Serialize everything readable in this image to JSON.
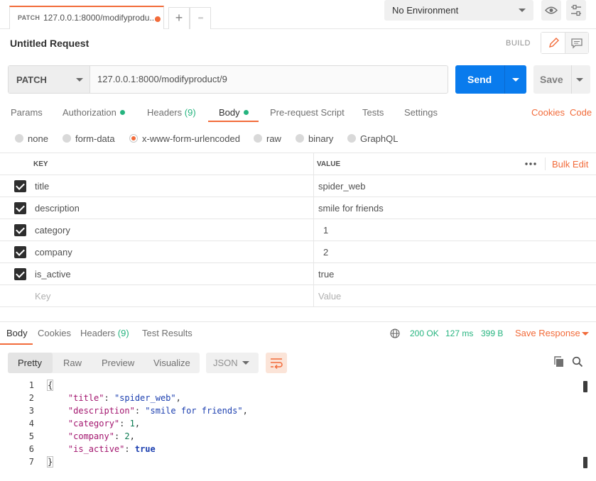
{
  "tabbar": {
    "tab_method": "PATCH",
    "tab_url": "127.0.0.1:8000/modifyprodu...",
    "add_tab_glyph": "+",
    "more_glyph": "◦◦◦",
    "environment": "No Environment"
  },
  "request": {
    "title": "Untitled Request",
    "build_label": "BUILD",
    "method": "PATCH",
    "url": "127.0.0.1:8000/modifyproduct/9",
    "send_label": "Send",
    "save_label": "Save"
  },
  "request_tabs": {
    "params": "Params",
    "authorization": "Authorization",
    "headers": "Headers",
    "headers_count": "(9)",
    "body": "Body",
    "prerequest": "Pre-request Script",
    "tests": "Tests",
    "settings": "Settings",
    "cookies": "Cookies",
    "code": "Code"
  },
  "body_types": {
    "none": "none",
    "form_data": "form-data",
    "urlencoded": "x-www-form-urlencoded",
    "raw": "raw",
    "binary": "binary",
    "graphql": "GraphQL",
    "selected": "x-www-form-urlencoded"
  },
  "params_table": {
    "key_header": "KEY",
    "value_header": "VALUE",
    "bulk_edit": "Bulk Edit",
    "rows": [
      {
        "key": "title",
        "value": "spider_web",
        "checked": true
      },
      {
        "key": "description",
        "value": "smile for friends",
        "checked": true
      },
      {
        "key": "category",
        "value": "1",
        "checked": true
      },
      {
        "key": "company",
        "value": "2",
        "checked": true
      },
      {
        "key": "is_active",
        "value": "true",
        "checked": true
      }
    ],
    "key_placeholder": "Key",
    "value_placeholder": "Value"
  },
  "response": {
    "tabs": {
      "body": "Body",
      "cookies": "Cookies",
      "headers": "Headers",
      "headers_count": "(9)",
      "test_results": "Test Results"
    },
    "status": "200 OK",
    "time": "127 ms",
    "size": "399 B",
    "save_response": "Save Response",
    "view_modes": {
      "pretty": "Pretty",
      "raw": "Raw",
      "preview": "Preview",
      "visualize": "Visualize"
    },
    "format": "JSON",
    "line_numbers": [
      "1",
      "2",
      "3",
      "4",
      "5",
      "6",
      "7"
    ],
    "json": {
      "open": "{",
      "close": "}",
      "fields": [
        {
          "key": "\"title\"",
          "value": "\"spider_web\"",
          "kind": "string",
          "comma": ","
        },
        {
          "key": "\"description\"",
          "value": "\"smile for friends\"",
          "kind": "string",
          "comma": ","
        },
        {
          "key": "\"category\"",
          "value": "1",
          "kind": "number",
          "comma": ","
        },
        {
          "key": "\"company\"",
          "value": "2",
          "kind": "number",
          "comma": ","
        },
        {
          "key": "\"is_active\"",
          "value": "true",
          "kind": "bool",
          "comma": ""
        }
      ]
    }
  },
  "colors": {
    "accent": "#f26b3a",
    "send_blue": "#097bed",
    "status_green": "#26b47f"
  },
  "icons": [
    "settings-sliders-icon",
    "eye-icon",
    "pencil-icon",
    "comment-icon",
    "globe-icon",
    "copy-icon",
    "search-icon",
    "wrap-lines-icon",
    "chevron-down-icon"
  ]
}
